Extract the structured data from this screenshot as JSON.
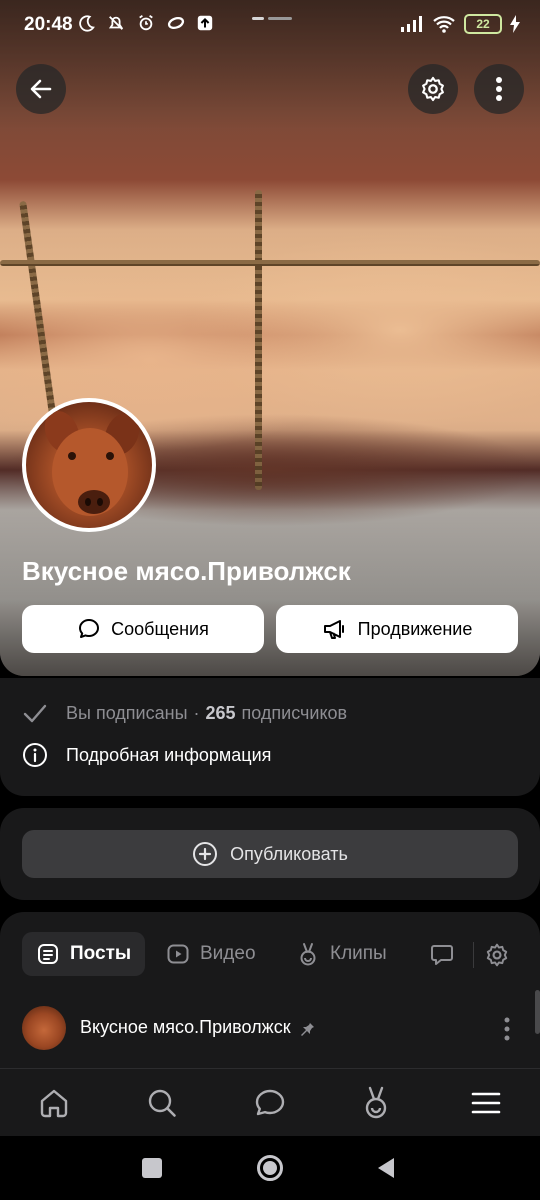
{
  "status_bar": {
    "time": "20:48",
    "icons": [
      "moon-icon",
      "mute-icon",
      "alarm-icon",
      "sync-icon",
      "upload-icon"
    ],
    "battery": "22"
  },
  "header": {
    "back_icon": "back-arrow-icon",
    "settings_icon": "gear-icon",
    "more_icon": "more-vertical-icon"
  },
  "group": {
    "name": "Вкусное мясо.Приволжск",
    "messages_label": "Сообщения",
    "promotion_label": "Продвижение"
  },
  "info": {
    "subscribed": "Вы подписаны",
    "separator": "·",
    "subscribers_count": "265",
    "subscribers_label": "подписчиков",
    "details_label": "Подробная информация"
  },
  "publish": {
    "label": "Опубликовать"
  },
  "tabs": [
    {
      "label": "Посты",
      "icon": "posts-icon",
      "active": true
    },
    {
      "label": "Видео",
      "icon": "video-icon",
      "active": false
    },
    {
      "label": "Клипы",
      "icon": "clips-icon",
      "active": false
    },
    {
      "label": "",
      "icon": "comments-icon",
      "active": false
    }
  ],
  "post": {
    "author": "Вкусное мясо.Приволжск",
    "pinned_icon": "pin-icon"
  },
  "bottom_nav": [
    "home-icon",
    "search-icon",
    "messages-icon",
    "clips-icon",
    "menu-icon"
  ],
  "colors": {
    "background": "#000000",
    "card": "#19191a",
    "muted": "#8e8e93",
    "battery": "#cfe8a0"
  }
}
